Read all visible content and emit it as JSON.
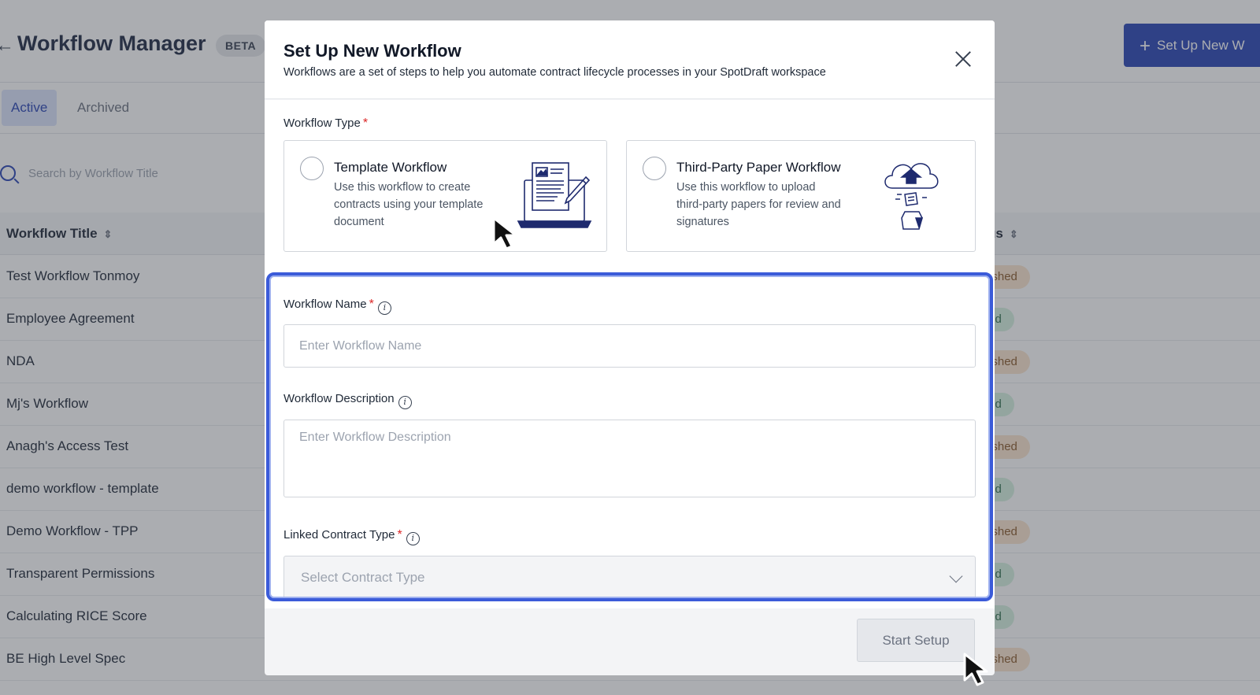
{
  "background": {
    "title": "Workflow Manager",
    "badge": "BETA",
    "setup_button": "Set Up New W",
    "tabs": [
      "Active",
      "Archived"
    ],
    "search_placeholder": "Search by Workflow Title",
    "columns": {
      "title": "Workflow Title",
      "status": "us"
    },
    "rows": [
      {
        "title": "Test Workflow Tonmoy",
        "status": "ublished",
        "kind": "pub"
      },
      {
        "title": "Employee Agreement",
        "status": "ished",
        "kind": "unpub"
      },
      {
        "title": "NDA",
        "status": "ublished",
        "kind": "pub"
      },
      {
        "title": "Mj's Workflow",
        "status": "ished",
        "kind": "unpub"
      },
      {
        "title": "Anagh's Access Test",
        "status": "ublished",
        "kind": "pub"
      },
      {
        "title": "demo workflow - template",
        "status": "ished",
        "kind": "unpub"
      },
      {
        "title": "Demo Workflow - TPP",
        "status": "ublished",
        "kind": "pub"
      },
      {
        "title": "Transparent Permissions",
        "status": "ished",
        "kind": "unpub"
      },
      {
        "title": "Calculating RICE Score",
        "status": "ished",
        "kind": "unpub"
      },
      {
        "title": "BE High Level Spec",
        "status": "ublished",
        "kind": "pub"
      }
    ]
  },
  "modal": {
    "title": "Set Up New Workflow",
    "subtitle": "Workflows are a set of steps to help you automate contract lifecycle processes in your SpotDraft workspace",
    "workflow_type_label": "Workflow Type",
    "cards": [
      {
        "title": "Template Workflow",
        "description": "Use this workflow to create contracts using your template document",
        "icon": "laptop-document-icon"
      },
      {
        "title": "Third-Party Paper Workflow",
        "description": "Use this workflow to upload third-party papers for review and signatures",
        "icon": "cloud-upload-icon"
      }
    ],
    "name_label": "Workflow Name",
    "name_placeholder": "Enter Workflow Name",
    "description_label": "Workflow Description",
    "description_placeholder": "Enter Workflow Description",
    "contract_type_label": "Linked Contract Type",
    "contract_type_placeholder": "Select Contract Type",
    "start_button": "Start Setup"
  },
  "colors": {
    "primary": "#2a45b5",
    "focus": "#3b5bd9",
    "required": "#dc2626"
  }
}
